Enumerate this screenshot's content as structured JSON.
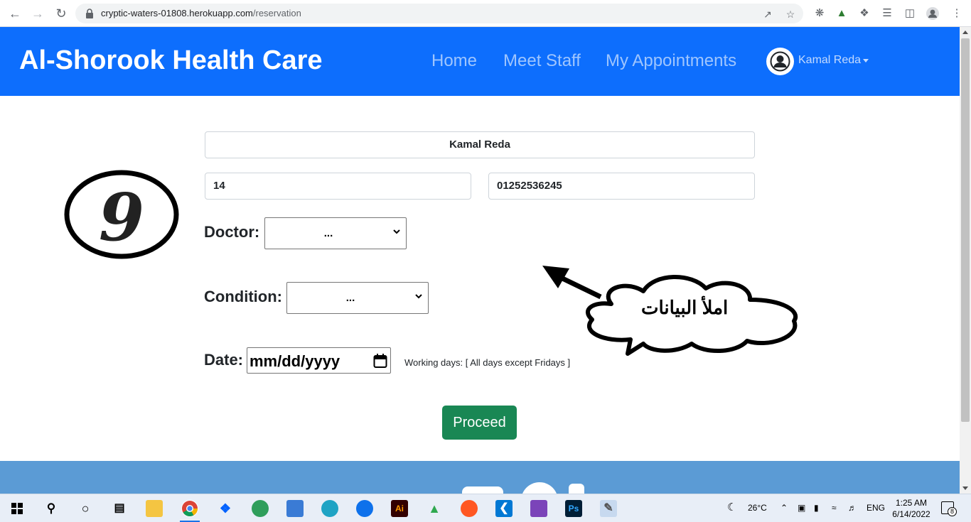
{
  "browser": {
    "url_host": "cryptic-waters-01808.herokuapp.com",
    "url_path": "/reservation"
  },
  "navbar": {
    "brand": "Al-Shorook Health Care",
    "links": [
      "Home",
      "Meet Staff",
      "My Appointments"
    ],
    "user_name": "Kamal Reda"
  },
  "form": {
    "name_value": "Kamal Reda",
    "age_value": "14",
    "phone_value": "01252536245",
    "doctor_label": "Doctor:",
    "doctor_selected": "...",
    "condition_label": "Condition:",
    "condition_selected": "...",
    "date_label": "Date:",
    "date_placeholder": "mm/dd/yyyy",
    "working_days": "Working days: [ All days except Fridays ]",
    "proceed_label": "Proceed"
  },
  "annotation": {
    "step_number": "9",
    "callout_text": "املأ البيانات"
  },
  "taskbar": {
    "weather": "26°C",
    "language": "ENG",
    "time": "1:25 AM",
    "date": "6/14/2022",
    "notifications": "8"
  }
}
